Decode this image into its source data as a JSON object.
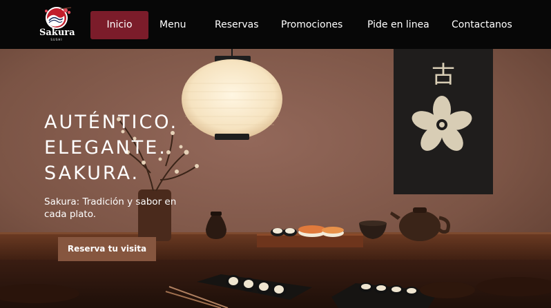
{
  "brand": {
    "name": "Sakura",
    "subtitle": "SUSHI"
  },
  "nav": {
    "items": [
      {
        "label": "Inicio",
        "active": true
      },
      {
        "label": "Menu",
        "active": false
      },
      {
        "label": "Reservas",
        "active": false
      },
      {
        "label": "Promociones",
        "active": false
      },
      {
        "label": "Pide en linea",
        "active": false
      },
      {
        "label": "Contactanos",
        "active": false
      }
    ]
  },
  "hero": {
    "headline": [
      "AUTÉNTICO.",
      "ELEGANTE.",
      "SAKURA."
    ],
    "tagline": "Sakura: Tradición y sabor en cada plato.",
    "cta_label": "Reserva tu visita",
    "banner_kanji": "古"
  },
  "colors": {
    "header_bg": "#070707",
    "active_nav": "#7b1c2a",
    "cta_bg": "#86563f",
    "wall": "#7a5444",
    "table": "#5a2e1a"
  }
}
